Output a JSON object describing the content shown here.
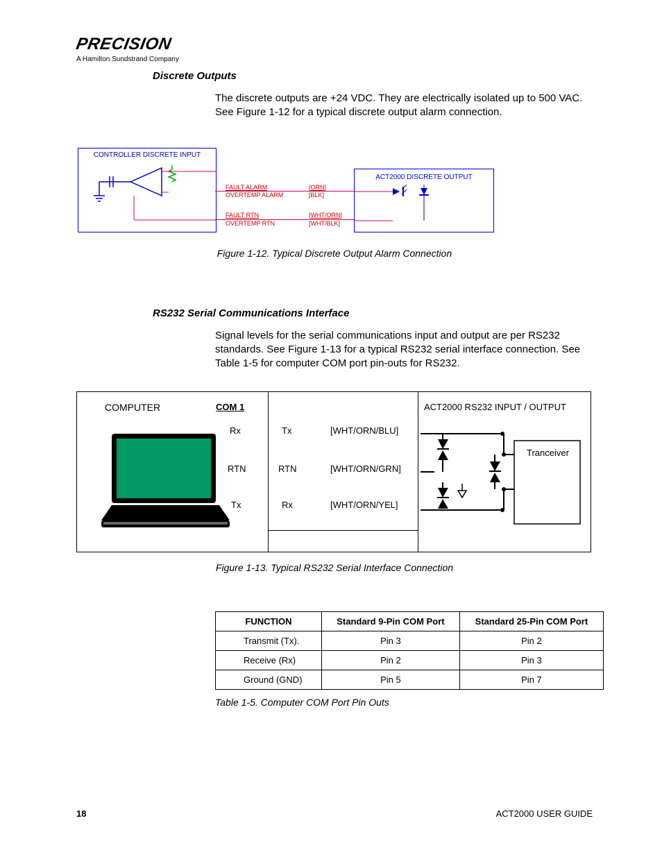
{
  "logo": {
    "name": "PRECISION",
    "sub": "A Hamilton Sundstrand Company"
  },
  "section1": {
    "heading": "Discrete Outputs",
    "para": "The discrete outputs are +24 VDC. They are electrically isolated up to 500 VAC. See Figure 1-12 for a typical discrete output alarm connection."
  },
  "fig12": {
    "controller_title": "CONTROLLER DISCRETE INPUT",
    "output_title": "ACT2000  DISCRETE OUTPUT",
    "labels": {
      "fault_alarm": "FAULT ALARM",
      "fault_alarm_clr": "[ORN]",
      "overtemp_alarm": "OVERTEMP ALARM",
      "overtemp_alarm_clr": "[BLK]",
      "fault_rtn": "FAULT RTN",
      "fault_rtn_clr": "[WHT/ORN]",
      "overtemp_rtn": "OVERTEMP RTN",
      "overtemp_rtn_clr": "[WHT/BLK]"
    },
    "caption": "Figure 1-12.  Typical Discrete Output Alarm Connection"
  },
  "section2": {
    "heading": "RS232 Serial Communications Interface",
    "para": "Signal levels for the serial communications input and output are per RS232 standards. See Figure 1-13 for a typical RS232 serial interface connection. See Table 1-5 for computer COM port pin-outs for RS232."
  },
  "fig13": {
    "computer": "COMPUTER",
    "com1": "COM 1",
    "rx": "Rx",
    "rtn": "RTN",
    "tx": "Tx",
    "rtn2": "RTN",
    "rx2": "Rx",
    "tx2": "Tx",
    "wire1": "[WHT/ORN/BLU]",
    "wire2": "[WHT/ORN/GRN]",
    "wire3": "[WHT/ORN/YEL]",
    "box_title": "ACT2000  RS232 INPUT / OUTPUT",
    "tranceiver": "Tranceiver",
    "caption": "Figure 1-13.  Typical RS232 Serial Interface Connection"
  },
  "table": {
    "headers": {
      "func": "FUNCTION",
      "p9": "Standard 9-Pin COM Port",
      "p25": "Standard 25-Pin COM Port"
    },
    "rows": [
      {
        "func": "Transmit  (Tx).",
        "p9": "Pin 3",
        "p25": "Pin 2"
      },
      {
        "func": "Receive  (Rx)",
        "p9": "Pin 2",
        "p25": "Pin 3"
      },
      {
        "func": "Ground  (GND)",
        "p9": "Pin 5",
        "p25": "Pin 7"
      }
    ],
    "caption": "Table 1-5.  Computer COM Port Pin Outs"
  },
  "footer": {
    "page": "18",
    "guide": "ACT2000 USER GUIDE"
  }
}
